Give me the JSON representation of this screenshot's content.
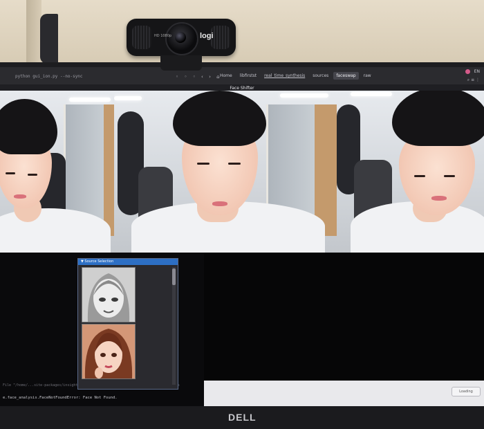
{
  "webcam": {
    "brand": "logi",
    "resolution_badge": "HD 1080p"
  },
  "taskbar": {
    "terminal_title": "python gui_ion.py --no-sync",
    "nav_buttons": "◦ ◦ ◦ ‹ › ⌂",
    "breadcrumbs": [
      "Home",
      "libfirstst",
      "real_time_synthesis",
      "sources",
      "faceswap",
      "raw"
    ],
    "tray_lang": "EN",
    "tray_icons": "⌕ ≡ ⋮"
  },
  "app": {
    "window_title": "Face Shifter"
  },
  "source_selection": {
    "title": "▼ Source Selection"
  },
  "terminal": {
    "error_line": "e.face_analysis.FaceNotFoundError: Face Not Found.",
    "trace_line": "File \"/home/...site-packages/insightface/app/face_analysis.py\", line 33, in get_faces"
  },
  "status_pill": "Loading",
  "monitor": {
    "brand": "DELL"
  }
}
